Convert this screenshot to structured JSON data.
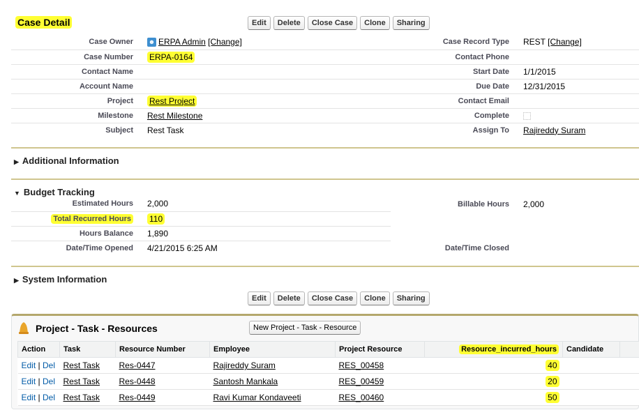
{
  "case_detail": {
    "title": "Case Detail"
  },
  "buttons": {
    "edit": "Edit",
    "delete": "Delete",
    "close_case": "Close Case",
    "clone": "Clone",
    "sharing": "Sharing"
  },
  "fields": {
    "case_owner": {
      "label": "Case Owner",
      "value": "ERPA Admin",
      "change": "[Change]"
    },
    "case_record_type": {
      "label": "Case Record Type",
      "value": "REST",
      "change": "[Change]"
    },
    "case_number": {
      "label": "Case Number",
      "value": "ERPA-0164"
    },
    "contact_phone": {
      "label": "Contact Phone",
      "value": ""
    },
    "contact_name": {
      "label": "Contact Name",
      "value": ""
    },
    "start_date": {
      "label": "Start Date",
      "value": "1/1/2015"
    },
    "account_name": {
      "label": "Account Name",
      "value": ""
    },
    "due_date": {
      "label": "Due Date",
      "value": "12/31/2015"
    },
    "project": {
      "label": "Project",
      "value": "Rest Project"
    },
    "contact_email": {
      "label": "Contact Email",
      "value": ""
    },
    "milestone": {
      "label": "Milestone",
      "value": "Rest Milestone"
    },
    "complete": {
      "label": "Complete",
      "checked": false
    },
    "subject": {
      "label": "Subject",
      "value": "Rest Task"
    },
    "assign_to": {
      "label": "Assign To",
      "value": "Rajireddy Suram"
    }
  },
  "sections": {
    "additional": "Additional Information",
    "budget": "Budget Tracking",
    "system": "System Information"
  },
  "budget": {
    "estimated_hours": {
      "label": "Estimated Hours",
      "value": "2,000"
    },
    "billable_hours": {
      "label": "Billable Hours",
      "value": "2,000"
    },
    "total_recurred_hours": {
      "label": "Total Recurred Hours",
      "value": "110"
    },
    "hours_balance": {
      "label": "Hours Balance",
      "value": "1,890"
    },
    "date_opened": {
      "label": "Date/Time Opened",
      "value": "4/21/2015 6:25 AM"
    },
    "date_closed": {
      "label": "Date/Time Closed",
      "value": ""
    }
  },
  "related_list": {
    "title": "Project - Task - Resources",
    "new_button": "New Project - Task -  Resource",
    "columns": [
      "Action",
      "Task",
      "Resource Number",
      "Employee",
      "Project Resource",
      "Resource_incurred_hours",
      "Candidate"
    ],
    "edit": "Edit",
    "sep": "|",
    "del": "Del",
    "rows": [
      {
        "task": "Rest Task",
        "resource_number": "Res-0447",
        "employee": "Rajireddy Suram",
        "project_resource": "RES_00458",
        "hours": "40",
        "candidate": ""
      },
      {
        "task": "Rest Task",
        "resource_number": "Res-0448",
        "employee": "Santosh Mankala",
        "project_resource": "RES_00459",
        "hours": "20",
        "candidate": ""
      },
      {
        "task": "Rest Task",
        "resource_number": "Res-0449",
        "employee": "Ravi Kumar Kondaveeti",
        "project_resource": "RES_00460",
        "hours": "50",
        "candidate": ""
      }
    ]
  }
}
